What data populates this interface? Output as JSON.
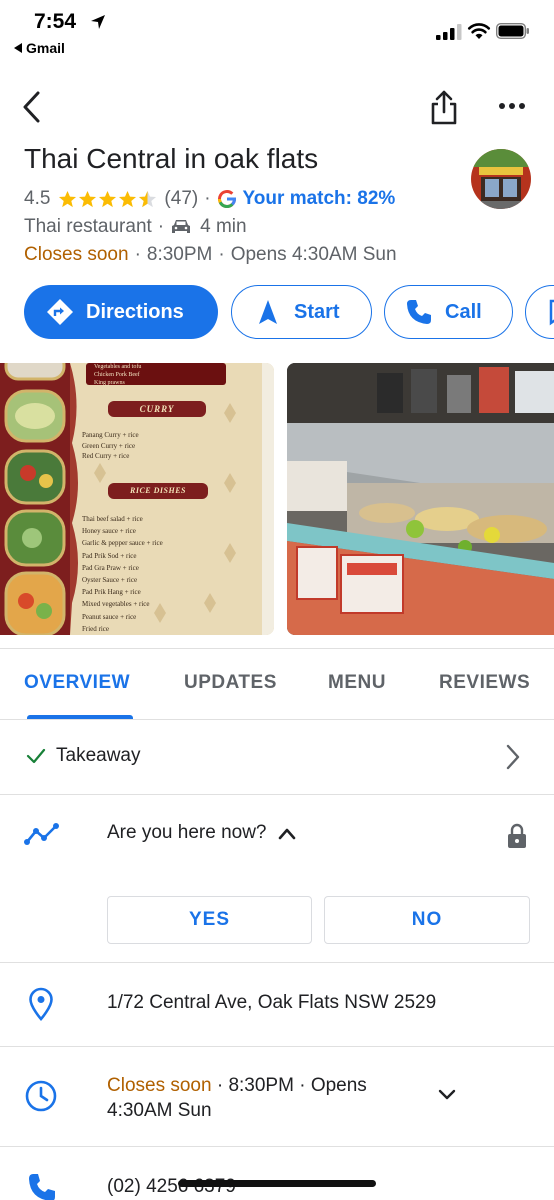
{
  "status_bar": {
    "time": "7:54",
    "back_app": "Gmail"
  },
  "place": {
    "name": "Thai Central in oak flats",
    "rating": "4.5",
    "rating_value": 4.5,
    "review_count": "(47)",
    "match": "Your match: 82%",
    "category": "Thai restaurant",
    "drive_time": "4 min",
    "closes_status": "Closes soon",
    "close_time": "8:30PM",
    "opens": "Opens 4:30AM Sun"
  },
  "actions": [
    {
      "label": "Directions",
      "icon": "directions-icon"
    },
    {
      "label": "Start",
      "icon": "navigation-arrow-icon"
    },
    {
      "label": "Call",
      "icon": "phone-icon"
    },
    {
      "label": "",
      "icon": "bookmark-icon"
    }
  ],
  "photo_menu_text": {
    "curry_heading": "CURRY",
    "curry_items": [
      "Panang Curry + rice",
      "Green Curry + rice",
      "Red Curry + rice"
    ],
    "rice_heading": "RICE DISHES",
    "rice_items": [
      "Thai beef salad + rice",
      "Honey sauce + rice",
      "Garlic & pepper sauce + rice",
      "Pad Prik Sod + rice",
      "Pad Gra Praw + rice",
      "Oyster Sauce + rice",
      "Pad Prik Hang + rice",
      "Mixed vegetables + rice",
      "Peanut sauce + rice",
      "Fried rice"
    ],
    "top_items": [
      "Vegetables and tofu",
      "Chicken Pork Beef",
      "King prawns"
    ]
  },
  "tabs": [
    "OVERVIEW",
    "UPDATES",
    "MENU",
    "REVIEWS"
  ],
  "active_tab": "OVERVIEW",
  "service_option": "Takeaway",
  "here_prompt": "Are you here now?",
  "yes_label": "YES",
  "no_label": "NO",
  "address": "1/72 Central Ave, Oak Flats NSW 2529",
  "hours_detail": {
    "status": "Closes soon",
    "close_time": "8:30PM",
    "opens_part1": "Opens",
    "opens_part2": "4:30AM Sun"
  },
  "phone": "(02) 4256 6379",
  "colors": {
    "accent": "#1a73e8",
    "closes_soon": "#b06000",
    "star": "#fbbc04",
    "text_primary": "#202124",
    "text_secondary": "#5f6368",
    "divider": "#e0e0e0"
  }
}
